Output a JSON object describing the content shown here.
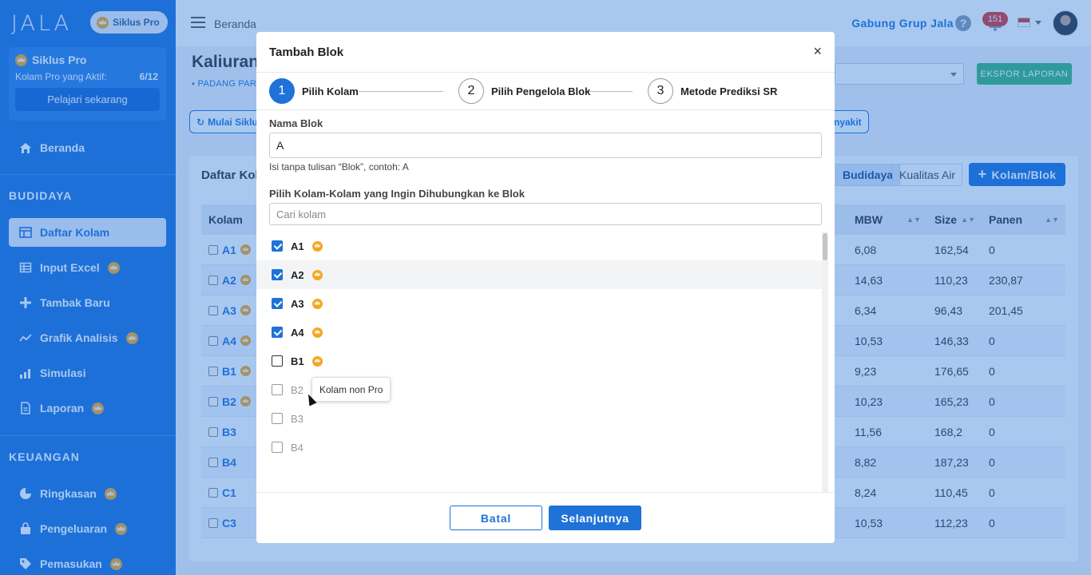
{
  "sidebar": {
    "logo": "JALA",
    "pro_pill": "Siklus Pro",
    "pro_card": {
      "title": "Siklus Pro",
      "active_label": "Kolam Pro yang Aktif:",
      "active_count": "6/12",
      "cta": "Pelajari sekarang"
    },
    "home": "Beranda",
    "section_budidaya": "BUDIDAYA",
    "items": [
      {
        "label": "Daftar Kolam",
        "icon": "pond-list-icon"
      },
      {
        "label": "Input Excel",
        "icon": "grid-icon"
      },
      {
        "label": "Tambak Baru",
        "icon": "plus-icon"
      },
      {
        "label": "Grafik Analisis",
        "icon": "chart-line-icon"
      },
      {
        "label": "Simulasi",
        "icon": "bar-chart-icon"
      },
      {
        "label": "Laporan",
        "icon": "file-icon"
      }
    ],
    "section_keuangan": "KEUANGAN",
    "finance_items": [
      {
        "label": "Ringkasan",
        "icon": "pie-icon"
      },
      {
        "label": "Pengeluaran",
        "icon": "bag-icon"
      },
      {
        "label": "Pemasukan",
        "icon": "tag-icon"
      }
    ]
  },
  "topbar": {
    "breadcrumb": "Beranda",
    "join_group": "Gabung Grup Jala",
    "notifications": "151"
  },
  "main": {
    "title": "Kaliuran",
    "location": "PADANG PARI",
    "export": "EKSPOR LAPORAN",
    "chip_start": "Mulai Siklu",
    "chip_disease": "nyakit",
    "panel_title": "Daftar Kol",
    "tab_budidaya": "Budidaya",
    "tab_water": "Kualitas Air",
    "add_button": "Kolam/Blok",
    "table": {
      "headers": {
        "kolam": "Kolam",
        "mbw": "MBW",
        "size": "Size",
        "panen": "Panen"
      },
      "rows": [
        {
          "name": "A1",
          "mbw": "6,08",
          "size": "162,54",
          "panen": "0"
        },
        {
          "name": "A2",
          "mbw": "14,63",
          "size": "110,23",
          "panen": "230,87"
        },
        {
          "name": "A3",
          "mbw": "6,34",
          "size": "96,43",
          "panen": "201,45"
        },
        {
          "name": "A4",
          "mbw": "10,53",
          "size": "146,33",
          "panen": "0"
        },
        {
          "name": "B1",
          "mbw": "9,23",
          "size": "176,65",
          "panen": "0"
        },
        {
          "name": "B2",
          "mbw": "10,23",
          "size": "165,23",
          "panen": "0"
        },
        {
          "name": "B3",
          "mbw": "11,56",
          "size": "168,2",
          "panen": "0"
        },
        {
          "name": "B4",
          "mbw": "8,82",
          "size": "187,23",
          "panen": "0"
        },
        {
          "name": "C1",
          "mbw": "8,24",
          "size": "110,45",
          "panen": "0"
        },
        {
          "name": "C3",
          "mbw": "10,53",
          "size": "112,23",
          "panen": "0"
        }
      ]
    }
  },
  "modal": {
    "title": "Tambah Blok",
    "close": "×",
    "steps": [
      {
        "num": "1",
        "label": "Pilih Kolam"
      },
      {
        "num": "2",
        "label": "Pilih Pengelola Blok"
      },
      {
        "num": "3",
        "label": "Metode Prediksi SR"
      }
    ],
    "block_name_label": "Nama Blok",
    "block_name_value": "A",
    "block_name_helper": "Isi tanpa tulisan “Blok”, contoh: A",
    "ponds_label": "Pilih Kolam-Kolam yang Ingin Dihubungkan ke Blok",
    "search_placeholder": "Cari kolam",
    "ponds": [
      {
        "name": "A1",
        "checked": true,
        "pro": true
      },
      {
        "name": "A2",
        "checked": true,
        "pro": true
      },
      {
        "name": "A3",
        "checked": true,
        "pro": true
      },
      {
        "name": "A4",
        "checked": true,
        "pro": true
      },
      {
        "name": "B1",
        "checked": false,
        "pro": true
      },
      {
        "name": "B2",
        "checked": false,
        "pro": false
      },
      {
        "name": "B3",
        "checked": false,
        "pro": false
      },
      {
        "name": "B4",
        "checked": false,
        "pro": false
      }
    ],
    "tooltip": "Kolam non Pro",
    "cancel": "Batal",
    "next": "Selanjutnya"
  },
  "colors": {
    "primary": "#1e72d8",
    "pro_crown": "#f5a623",
    "export_green": "#3bb578",
    "badge_red": "#d9372f"
  }
}
